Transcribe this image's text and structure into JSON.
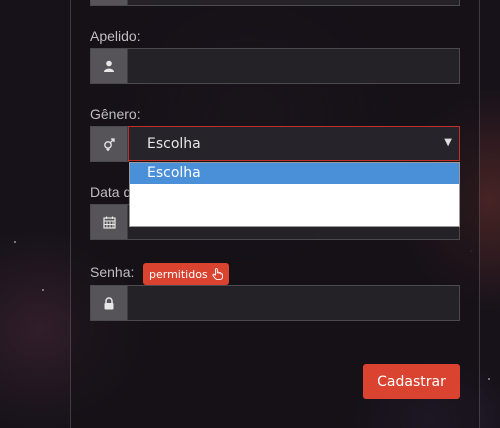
{
  "form": {
    "apelido": {
      "label": "Apelido:",
      "value": "",
      "placeholder": ""
    },
    "genero": {
      "label": "Gênero:",
      "selected": "Escolha",
      "options": [
        "Escolha"
      ]
    },
    "data_label": "Data d",
    "senha": {
      "label": "Senha:",
      "badge": "permitidos",
      "value": ""
    },
    "submit_label": "Cadastrar"
  },
  "icons": {
    "apelido": "user-icon",
    "genero": "gender-icon",
    "data": "calendar-icon",
    "senha": "lock-icon",
    "badge": "hand-pointer-icon",
    "select_caret": "caret-down-icon"
  },
  "colors": {
    "accent": "#d9432f",
    "dropdown_highlight": "#4a90d9"
  }
}
